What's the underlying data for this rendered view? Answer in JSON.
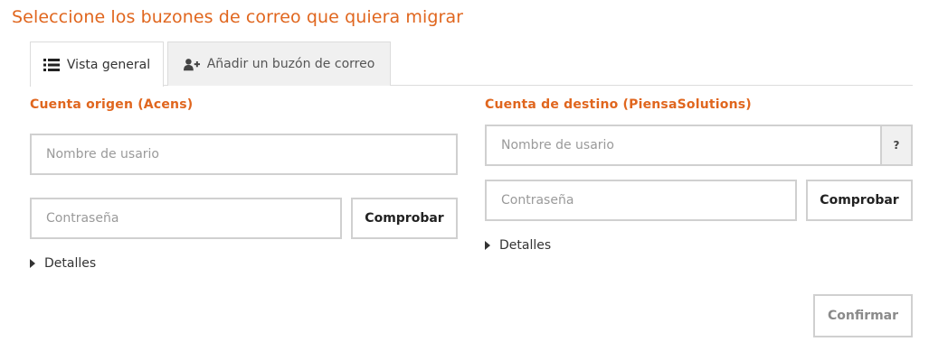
{
  "page": {
    "title": "Seleccione los buzones de correo que quiera migrar"
  },
  "tabs": [
    {
      "label": "Vista general",
      "icon": "list-icon",
      "active": true
    },
    {
      "label": "Añadir un buzón de correo",
      "icon": "add-user-icon",
      "active": false
    }
  ],
  "source": {
    "title": "Cuenta origen (Acens)",
    "username_placeholder": "Nombre de usario",
    "username_value": "",
    "password_placeholder": "Contraseña",
    "password_value": "",
    "check_label": "Comprobar",
    "details_label": "Detalles"
  },
  "destination": {
    "title": "Cuenta de destino (PiensaSolutions)",
    "username_placeholder": "Nombre de usario",
    "username_value": "",
    "help_label": "?",
    "password_placeholder": "Contraseña",
    "password_value": "",
    "check_label": "Comprobar",
    "details_label": "Detalles"
  },
  "confirm_label": "Confirmar",
  "colors": {
    "accent": "#e0661e",
    "border": "#d0d0d0",
    "tab_inactive_bg": "#f0f0f0"
  }
}
